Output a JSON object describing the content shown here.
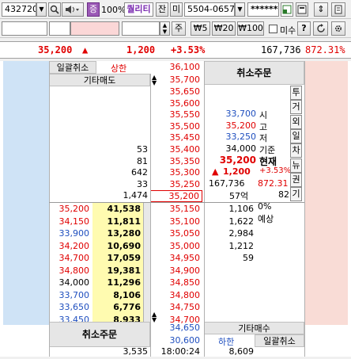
{
  "toolbar1": {
    "code": "432720",
    "pct_label": "100%",
    "quality_label": "퀄리티",
    "jan_label": "잔",
    "mi_label": "미",
    "account": "5504-0657",
    "password": "******"
  },
  "toolbar2": {
    "ju_label": "주",
    "price_btns": [
      "₩5",
      "₩20",
      "₩100"
    ],
    "misu_label": "미수",
    "help_label": "?"
  },
  "summary": {
    "price": "35,200",
    "arrow": "▲",
    "change": "1,200",
    "rate": "+3.53%",
    "volume": "167,736",
    "ratio": "872.31%"
  },
  "header": {
    "bulk_cancel_top": "일괄취소",
    "upper_limit_label": "상한",
    "upper_limit_price": "36,100",
    "other_sell": "기타매도",
    "other_sell_price": "35,700",
    "cancel_order_top": "취소주문"
  },
  "asks": [
    {
      "qty": "",
      "price": "35,650"
    },
    {
      "qty": "",
      "price": "35,600"
    },
    {
      "qty": "",
      "price": "35,550"
    },
    {
      "qty": "",
      "price": "35,500"
    },
    {
      "qty": "",
      "price": "35,450"
    },
    {
      "qty": "53",
      "price": "35,400"
    },
    {
      "qty": "81",
      "price": "35,350"
    },
    {
      "qty": "642",
      "price": "35,300"
    },
    {
      "qty": "33",
      "price": "35,250"
    },
    {
      "qty": "1,474",
      "price": "35,200"
    }
  ],
  "info": [
    {
      "val": "33,700",
      "label": "시",
      "color": "#1f4fbf"
    },
    {
      "val": "35,200",
      "label": "고",
      "color": "#e00000"
    },
    {
      "val": "33,250",
      "label": "저",
      "color": "#1f4fbf"
    },
    {
      "val": "34,000",
      "label": "기준",
      "color": "#000000"
    },
    {
      "val": "35,200",
      "label": "현재",
      "color": "#e00000"
    }
  ],
  "info_change": {
    "arrow": "▲",
    "val": "1,200",
    "rate": "+3.53%"
  },
  "info_volume": {
    "vol": "167,736",
    "ratio": "872.31"
  },
  "info_amount": {
    "amt": "57억",
    "n": "82"
  },
  "info_pct": "0%",
  "info_expected": "예상",
  "side_tabs": [
    "투",
    "거",
    "외",
    "일",
    "차",
    "뉴",
    "권",
    "기"
  ],
  "bids": [
    {
      "hist": "35,200",
      "qty": "41,538",
      "price": "35,150",
      "right": "1,106",
      "hcolor": "#e00000"
    },
    {
      "hist": "34,150",
      "qty": "11,811",
      "price": "35,100",
      "right": "1,622",
      "hcolor": "#e00000"
    },
    {
      "hist": "33,900",
      "qty": "13,280",
      "price": "35,050",
      "right": "2,984",
      "hcolor": "#1f4fbf"
    },
    {
      "hist": "34,200",
      "qty": "10,690",
      "price": "35,000",
      "right": "1,212",
      "hcolor": "#e00000"
    },
    {
      "hist": "34,700",
      "qty": "17,059",
      "price": "34,950",
      "right": "59",
      "hcolor": "#e00000"
    },
    {
      "hist": "34,800",
      "qty": "19,381",
      "price": "34,900",
      "right": "",
      "hcolor": "#e00000"
    },
    {
      "hist": "34,000",
      "qty": "11,296",
      "price": "34,850",
      "right": "",
      "hcolor": "#000000"
    },
    {
      "hist": "33,700",
      "qty": "8,106",
      "price": "34,800",
      "right": "",
      "hcolor": "#1f4fbf"
    },
    {
      "hist": "33,650",
      "qty": "6,776",
      "price": "34,750",
      "right": "",
      "hcolor": "#1f4fbf"
    },
    {
      "hist": "33,450",
      "qty": "8,933",
      "price": "34,700",
      "right": "",
      "hcolor": "#1f4fbf"
    }
  ],
  "footer": {
    "cancel_order_bottom": "취소주문",
    "other_buy_price": "34,650",
    "other_buy": "기타매수",
    "lower_limit_price": "30,600",
    "lower_limit_label": "하한",
    "bulk_cancel_bottom": "일괄취소",
    "total_ask": "3,535",
    "time": "18:00:24",
    "total_bid": "8,609"
  }
}
